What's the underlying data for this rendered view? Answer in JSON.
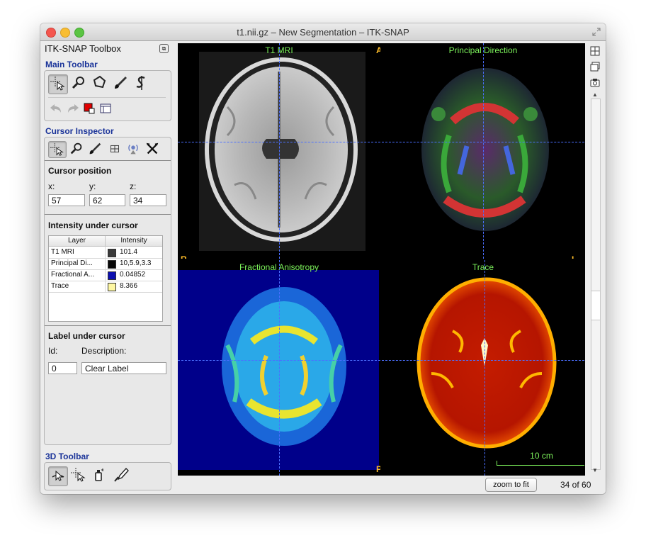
{
  "window": {
    "title": "t1.nii.gz – New Segmentation – ITK-SNAP"
  },
  "sidebar": {
    "title": "ITK-SNAP Toolbox",
    "main_toolbar": {
      "heading": "Main Toolbar"
    },
    "cursor_inspector": {
      "heading": "Cursor Inspector",
      "cursor_position_label": "Cursor position",
      "x_label": "x:",
      "y_label": "y:",
      "z_label": "z:",
      "x": "57",
      "y": "62",
      "z": "34",
      "intensity_label": "Intensity under cursor",
      "table": {
        "col_layer": "Layer",
        "col_intensity": "Intensity",
        "rows": [
          {
            "layer": "T1 MRI",
            "swatch": "#3a3a3a",
            "value": "101.4"
          },
          {
            "layer": "Principal Di...",
            "swatch": "#080808",
            "value": "10,5.9,3.3"
          },
          {
            "layer": "Fractional A...",
            "swatch": "#0d10b0",
            "value": "0.04852"
          },
          {
            "layer": "Trace",
            "swatch": "#fef7a2",
            "value": "8.366"
          }
        ]
      },
      "label_under_cursor": "Label under cursor",
      "id_label": "Id:",
      "description_label": "Description:",
      "id_value": "0",
      "description_value": "Clear Label"
    },
    "toolbar_3d": {
      "heading": "3D Toolbar"
    }
  },
  "viewer": {
    "views": [
      {
        "title": "T1 MRI"
      },
      {
        "title": "Principal Direction"
      },
      {
        "title": "Fractional Anisotropy"
      },
      {
        "title": "Trace"
      }
    ],
    "orientation": {
      "anterior": "A",
      "posterior": "P",
      "right": "R",
      "left": "L"
    },
    "scale_bar": "10 cm"
  },
  "bottom": {
    "zoom_button": "zoom to fit",
    "slice_indicator": "34 of 60"
  },
  "colors": {
    "accent": "#1a3399",
    "view_label": "#7cf25b",
    "orientation": "#ffbd29",
    "crosshair": "#4b6fff"
  }
}
